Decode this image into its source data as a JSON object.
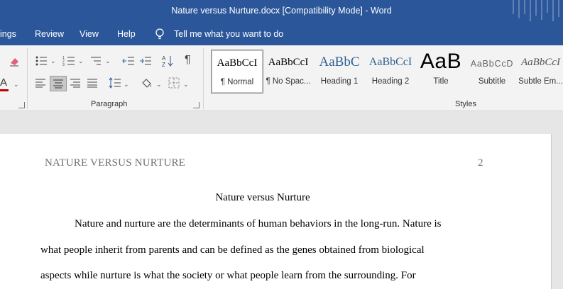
{
  "window": {
    "title": "Nature versus Nurture.docx  [Compatibility Mode]  -  Word"
  },
  "menu": {
    "items": [
      "ings",
      "Review",
      "View",
      "Help"
    ],
    "tell_me": "Tell me what you want to do"
  },
  "ribbon": {
    "paragraph_label": "Paragraph",
    "styles_label": "Styles",
    "styles": [
      {
        "sample": "AaBbCcI",
        "label": "¶ Normal"
      },
      {
        "sample": "AaBbCcI",
        "label": "¶ No Spac..."
      },
      {
        "sample": "AaBbC",
        "label": "Heading 1"
      },
      {
        "sample": "AaBbCcI",
        "label": "Heading 2"
      },
      {
        "sample": "AaB",
        "label": "Title"
      },
      {
        "sample": "AaBbCcD",
        "label": "Subtitle"
      },
      {
        "sample": "AaBbCcI",
        "label": "Subtle Em..."
      }
    ],
    "colors": {
      "font_color": "#c00000",
      "title_blue": "#2b579a"
    }
  },
  "document": {
    "header_left": "NATURE VERSUS NURTURE",
    "page_number": "2",
    "title": "Nature versus Nurture",
    "lines": [
      "Nature and nurture are the determinants of human behaviors in the long-run. Nature is",
      "what people inherit from parents and can be defined as the genes obtained from biological",
      "aspects while nurture is what the society or what people learn from the surrounding. For"
    ]
  }
}
